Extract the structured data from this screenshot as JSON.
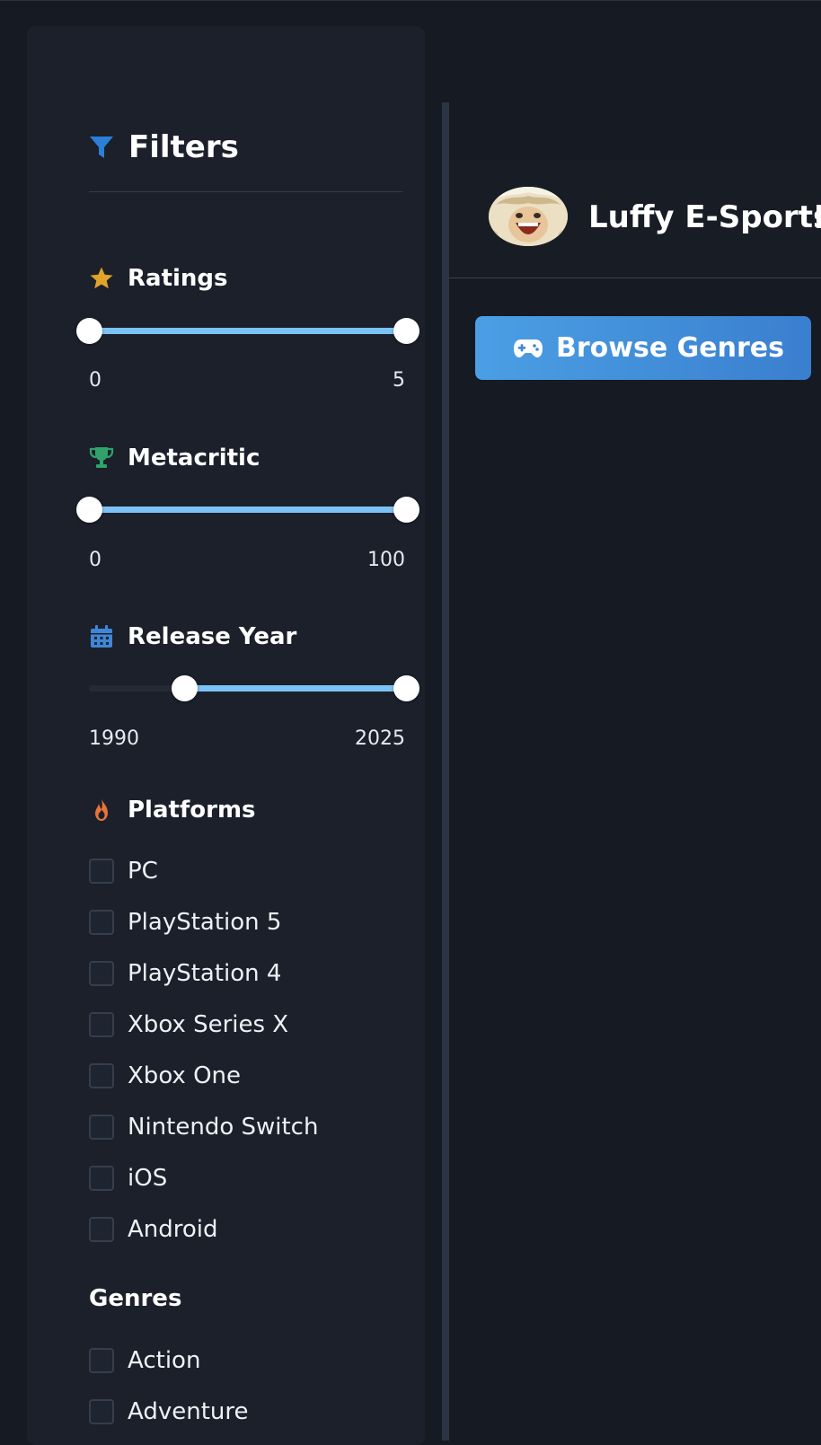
{
  "sidebar": {
    "title": "Filters",
    "filter_icon": "filter-icon",
    "ratings": {
      "label": "Ratings",
      "icon": "star-icon",
      "min_value": "0",
      "max_value": "5",
      "low_fraction": 0.0,
      "high_fraction": 1.0
    },
    "metacritic": {
      "label": "Metacritic",
      "icon": "trophy-icon",
      "min_value": "0",
      "max_value": "100",
      "low_fraction": 0.0,
      "high_fraction": 1.0
    },
    "release_year": {
      "label": "Release Year",
      "icon": "calendar-icon",
      "min_value": "1990",
      "max_value": "2025",
      "low_fraction": 0.3,
      "high_fraction": 1.0
    },
    "platforms": {
      "label": "Platforms",
      "icon": "fire-icon",
      "items": [
        "PC",
        "PlayStation 5",
        "PlayStation 4",
        "Xbox Series X",
        "Xbox One",
        "Nintendo Switch",
        "iOS",
        "Android"
      ]
    },
    "genres": {
      "label": "Genres",
      "items": [
        "Action",
        "Adventure"
      ]
    }
  },
  "header": {
    "brand": "Luffy E-Sports",
    "avatar_icon": "avatar"
  },
  "browse_button": {
    "label": "Browse Genres",
    "icon": "gamepad-icon"
  },
  "colors": {
    "accent": "#3f8fda",
    "slider_range": "#7cc2f6",
    "star": "#e2a32a",
    "trophy": "#2fa36b",
    "calendar": "#3f86d8",
    "fire": "#e8733a"
  }
}
